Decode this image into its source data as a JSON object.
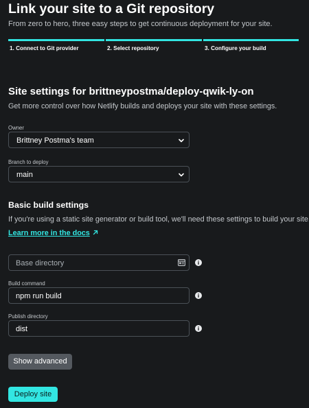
{
  "page": {
    "title": "Link your site to a Git repository",
    "subtitle": "From zero to hero, three easy steps to get continuous deployment for your site."
  },
  "steps": [
    {
      "label": "1. Connect to Git provider"
    },
    {
      "label": "2. Select repository"
    },
    {
      "label": "3. Configure your build"
    }
  ],
  "site_settings": {
    "heading": "Site settings for brittneypostma/deploy-qwik-ly-on",
    "description": "Get more control over how Netlify builds and deploys your site with these settings.",
    "owner_label": "Owner",
    "owner_value": "Brittney Postma's team",
    "branch_label": "Branch to deploy",
    "branch_value": "main"
  },
  "build_settings": {
    "heading": "Basic build settings",
    "description": "If you're using a static site generator or build tool, we'll need these settings to build your site.",
    "learn_more": "Learn more in the docs",
    "base_directory_placeholder": "Base directory",
    "build_command_label": "Build command",
    "build_command_value": "npm run build",
    "publish_directory_label": "Publish directory",
    "publish_directory_value": "dist"
  },
  "buttons": {
    "show_advanced": "Show advanced",
    "deploy": "Deploy site"
  },
  "icons": {
    "link": "external-arrow-icon",
    "info": "info-icon",
    "chevron": "chevron-down-icon",
    "directory": "directory-picker-icon"
  },
  "colors": {
    "background": "#181a1c",
    "accent": "#32e6e2",
    "secondary_button": "#54595f"
  }
}
